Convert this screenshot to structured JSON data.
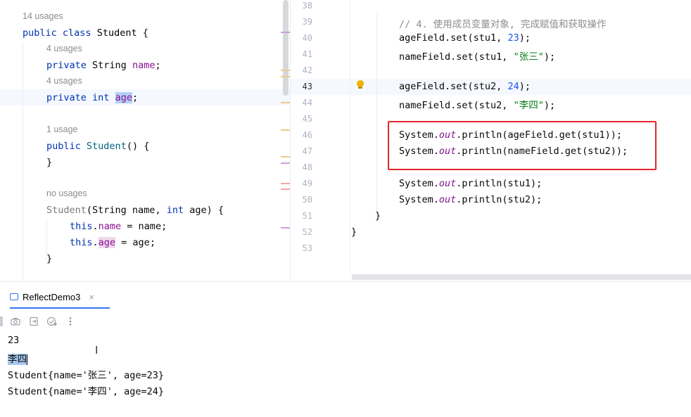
{
  "left_editor": {
    "hint_class_usages": "14 usages",
    "class_decl": {
      "kw1": "public",
      "kw2": "class",
      "name": "Student",
      "brace": " {"
    },
    "hint_name_usages": "4 usages",
    "field_name": {
      "kw": "private",
      "type": "String",
      "name": "name",
      "semi": ";"
    },
    "hint_age_usages": "4 usages",
    "field_age": {
      "kw": "private",
      "type": "int",
      "name": "age",
      "semi": ";"
    },
    "hint_ctor1_usages": "1 usage",
    "ctor1": {
      "kw": "public",
      "name": "Student",
      "rest": "() {"
    },
    "ctor1_close": "}",
    "hint_ctor2_usages": "no usages",
    "ctor2": {
      "name": "Student",
      "p1": "(String name, ",
      "kw": "int",
      "p2": " age) {"
    },
    "assign1": {
      "this": "this",
      "dot": ".",
      "field": "name",
      "rest": " = name;"
    },
    "assign2": {
      "this": "this",
      "dot": ".",
      "field": "age",
      "rest": " = age;"
    },
    "ctor2_close": "}"
  },
  "right_editor": {
    "line_numbers": [
      "38",
      "39",
      "40",
      "41",
      "42",
      "43",
      "44",
      "45",
      "46",
      "47",
      "48",
      "49",
      "50",
      "51",
      "52",
      "53"
    ],
    "comment": "// 4. 使用成员变量对象, 完成赋值和获取操作",
    "l40": {
      "a": "ageField.set(stu1, ",
      "num": "23",
      "b": ");"
    },
    "l41": {
      "a": "nameField.set(stu1, ",
      "str": "\"张三\"",
      "b": ");"
    },
    "l43": {
      "a": "ageField.set(stu2, ",
      "num": "24",
      "b": ");"
    },
    "l44": {
      "a": "nameField.set(stu2, ",
      "str": "\"李四\"",
      "b": ");"
    },
    "l46": {
      "a": "System.",
      "out": "out",
      "b": ".println(ageField.get(stu1));"
    },
    "l47": {
      "a": "System.",
      "out": "out",
      "b": ".println(nameField.get(stu2));"
    },
    "l49": {
      "a": "System.",
      "out": "out",
      "b": ".println(stu1);"
    },
    "l50": {
      "a": "System.",
      "out": "out",
      "b": ".println(stu2);"
    },
    "l51": "}",
    "l52": "}"
  },
  "run_panel": {
    "tab_label": "ReflectDemo3",
    "close_glyph": "×",
    "toolbar_icons": [
      "stop-icon",
      "camera-icon",
      "restore-layout-icon",
      "clear-icon",
      "more-icon"
    ],
    "output": [
      "23",
      "李四",
      "Student{name='张三', age=23}",
      "Student{name='李四', age=24}"
    ]
  },
  "colors": {
    "accent": "#3574f0",
    "highlight_box": "#e3262b",
    "keyword": "#0033b3",
    "field": "#871094",
    "string": "#067d17",
    "number": "#1750eb"
  }
}
